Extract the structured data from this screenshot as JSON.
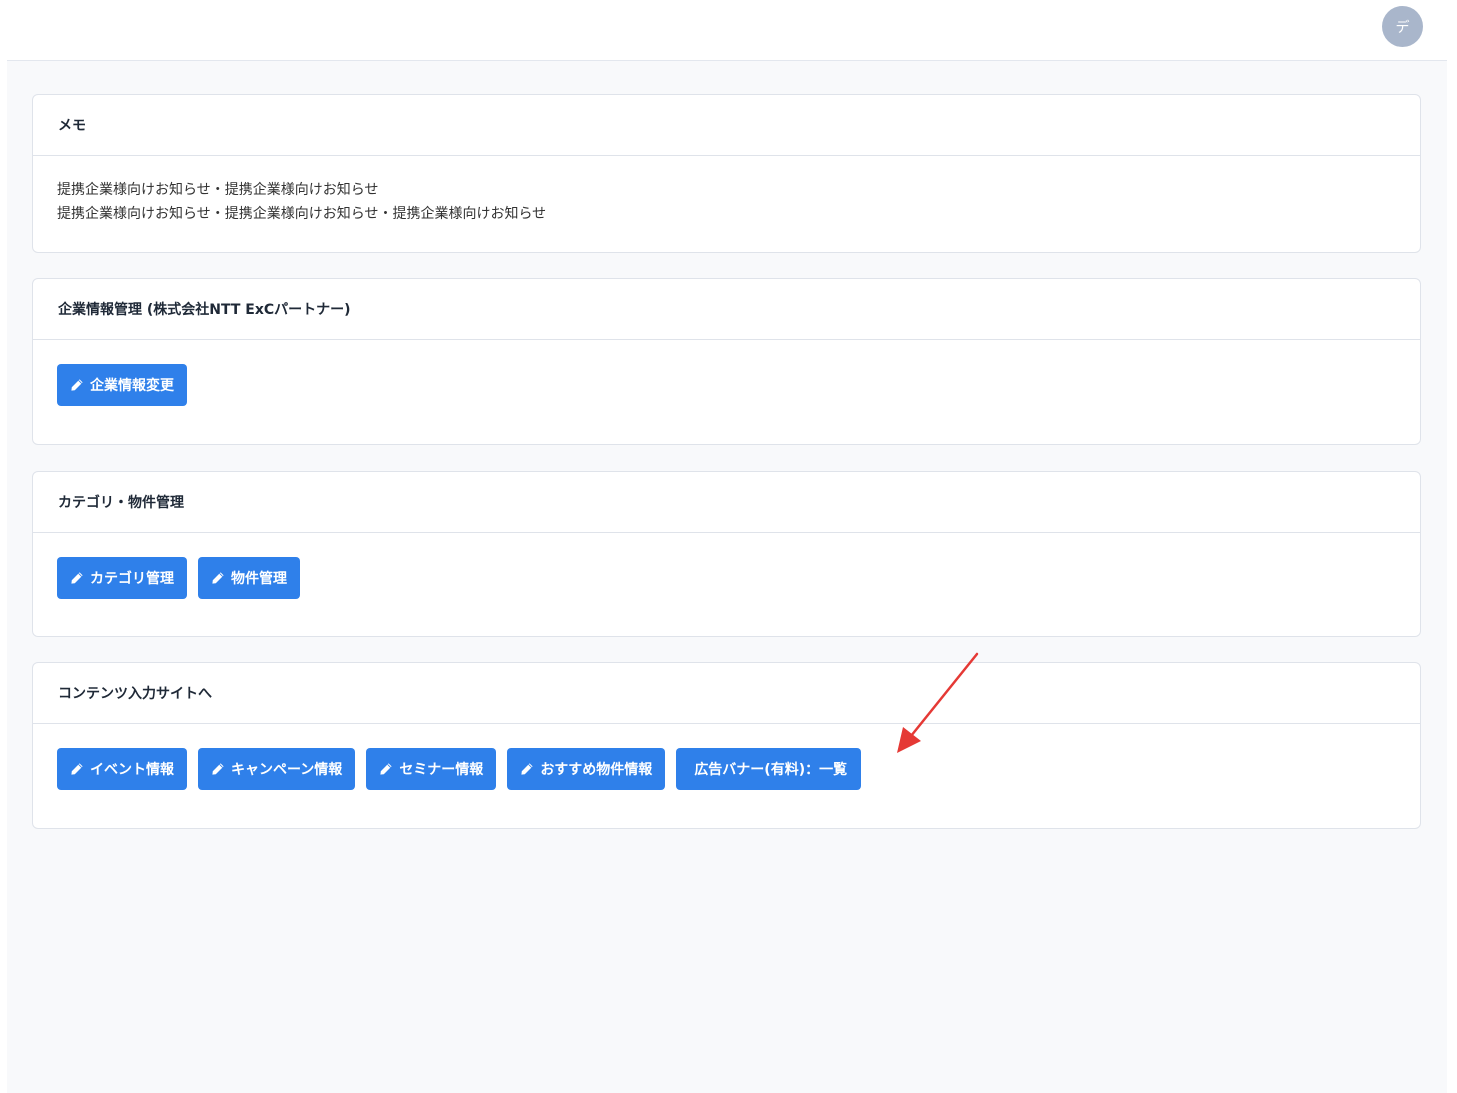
{
  "header": {
    "avatar_initial": "デ"
  },
  "memo": {
    "title": "メモ",
    "lines": [
      "提携企業様向けお知らせ・提携企業様向けお知らせ",
      "提携企業様向けお知らせ・提携企業様向けお知らせ・提携企業様向けお知らせ"
    ]
  },
  "company": {
    "title": "企業情報管理 (株式会社NTT ExCパートナー)",
    "buttons": [
      {
        "label": "企業情報変更",
        "icon": "pencil-icon"
      }
    ]
  },
  "category": {
    "title": "カテゴリ・物件管理",
    "buttons": [
      {
        "label": "カテゴリ管理",
        "icon": "pencil-icon"
      },
      {
        "label": "物件管理",
        "icon": "pencil-icon"
      }
    ]
  },
  "content": {
    "title": "コンテンツ入力サイトへ",
    "buttons": [
      {
        "label": "イベント情報",
        "icon": "pencil-icon"
      },
      {
        "label": "キャンペーン情報",
        "icon": "pencil-icon"
      },
      {
        "label": "セミナー情報",
        "icon": "pencil-icon"
      },
      {
        "label": "おすすめ物件情報",
        "icon": "pencil-icon"
      },
      {
        "label": "広告バナー(有料)：一覧",
        "icon": ""
      }
    ]
  },
  "colors": {
    "button_blue": "#2f80ea",
    "annotation_arrow": "#e53935",
    "avatar_bg": "#a9b6cb"
  }
}
